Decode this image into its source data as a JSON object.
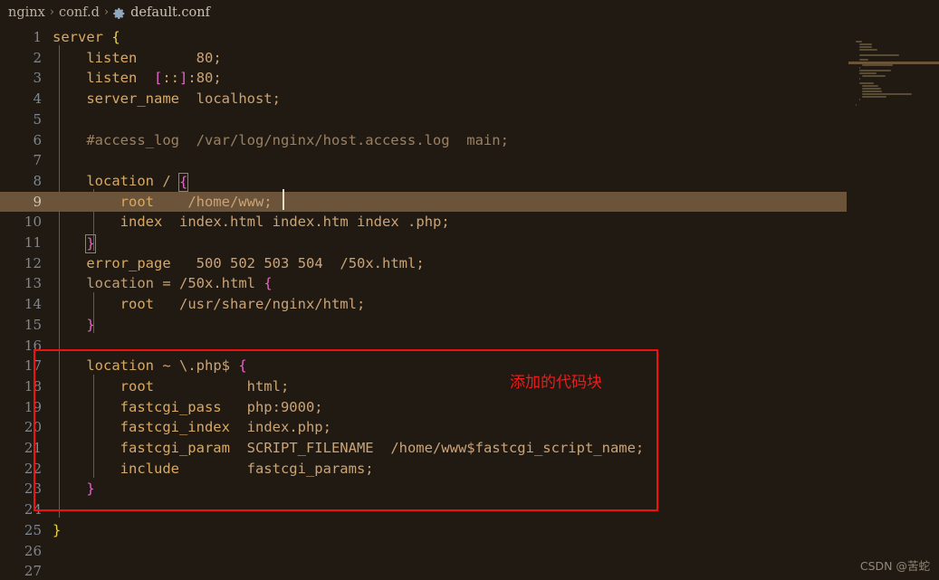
{
  "breadcrumb": {
    "root": "nginx",
    "folder": "conf.d",
    "separator": "›",
    "file_icon": "gear-icon",
    "filename": "default.conf"
  },
  "editor": {
    "language": "nginx-conf",
    "current_line": 9,
    "total_visible_lines": 27,
    "cursor": {
      "line": 9,
      "column": 26
    },
    "colors": {
      "background": "#211a12",
      "line_number": "#7f8791",
      "current_line_highlight": "#6b5439",
      "directive": "#d8a964",
      "value": "#caa477",
      "brace_magenta": "#e863c8",
      "brace_yellow": "#e8d44a",
      "comment": "#9a8163",
      "annotation_red": "#f01111"
    },
    "lines": [
      {
        "n": 1,
        "text": "server {"
      },
      {
        "n": 2,
        "text": "    listen       80;"
      },
      {
        "n": 3,
        "text": "    listen  [::]:80;"
      },
      {
        "n": 4,
        "text": "    server_name  localhost;"
      },
      {
        "n": 5,
        "text": ""
      },
      {
        "n": 6,
        "text": "    #access_log  /var/log/nginx/host.access.log  main;"
      },
      {
        "n": 7,
        "text": ""
      },
      {
        "n": 8,
        "text": "    location / {"
      },
      {
        "n": 9,
        "text": "        root    /home/www;"
      },
      {
        "n": 10,
        "text": "        index  index.html index.htm index .php;"
      },
      {
        "n": 11,
        "text": "    }"
      },
      {
        "n": 12,
        "text": "    error_page   500 502 503 504  /50x.html;"
      },
      {
        "n": 13,
        "text": "    location = /50x.html {"
      },
      {
        "n": 14,
        "text": "        root   /usr/share/nginx/html;"
      },
      {
        "n": 15,
        "text": "    }"
      },
      {
        "n": 16,
        "text": ""
      },
      {
        "n": 17,
        "text": "    location ~ \\.php$ {"
      },
      {
        "n": 18,
        "text": "        root           html;"
      },
      {
        "n": 19,
        "text": "        fastcgi_pass   php:9000;"
      },
      {
        "n": 20,
        "text": "        fastcgi_index  index.php;"
      },
      {
        "n": 21,
        "text": "        fastcgi_param  SCRIPT_FILENAME  /home/www$fastcgi_script_name;"
      },
      {
        "n": 22,
        "text": "        include        fastcgi_params;"
      },
      {
        "n": 23,
        "text": "    }"
      },
      {
        "n": 24,
        "text": ""
      },
      {
        "n": 25,
        "text": "}"
      },
      {
        "n": 26,
        "text": ""
      },
      {
        "n": 27,
        "text": ""
      }
    ]
  },
  "annotation": {
    "label": "添加的代码块",
    "highlight_from_line": 16,
    "highlight_to_line": 24
  },
  "minimap": {
    "name": "code-minimap"
  },
  "watermark": {
    "text": "CSDN @苦蛇"
  }
}
